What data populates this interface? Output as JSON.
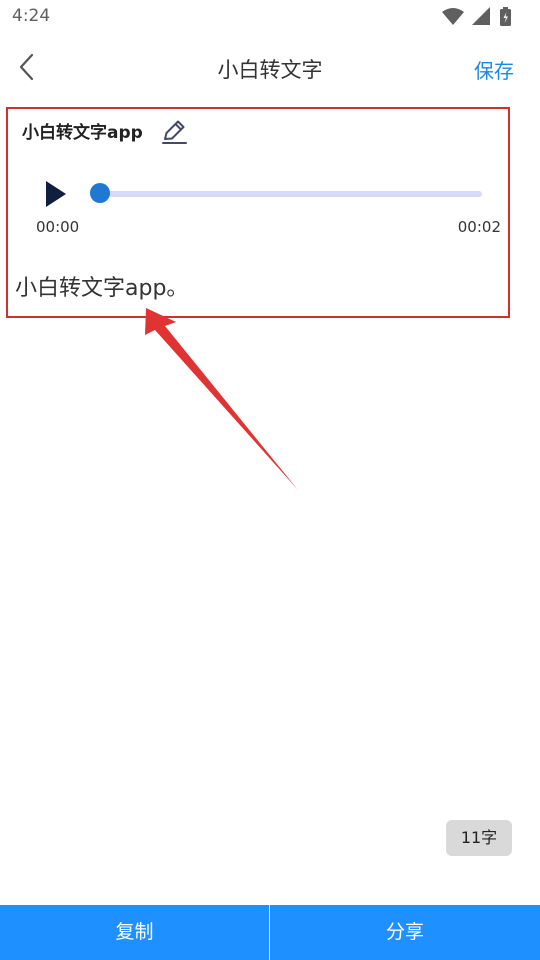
{
  "status_bar": {
    "time": "4:24",
    "icons": [
      "wifi-icon",
      "signal-icon",
      "battery-icon"
    ]
  },
  "header": {
    "title": "小白转文字",
    "save_label": "保存",
    "back_icon": "back-arrow-icon"
  },
  "note": {
    "name": "小白转文字app",
    "edit_icon": "pencil-icon",
    "player": {
      "play_icon": "play-icon",
      "current_time": "00:00",
      "total_time": "00:02",
      "progress": 0
    },
    "transcript": "小白转文字app。"
  },
  "char_count": "11字",
  "bottom_bar": {
    "copy_label": "复制",
    "share_label": "分享"
  },
  "colors": {
    "accent": "#1e88e5",
    "bottom_bar": "#1e90ff",
    "highlight_box": "#d32f2f",
    "progress_track": "#d6daf7",
    "progress_knob": "#1f78d1"
  }
}
